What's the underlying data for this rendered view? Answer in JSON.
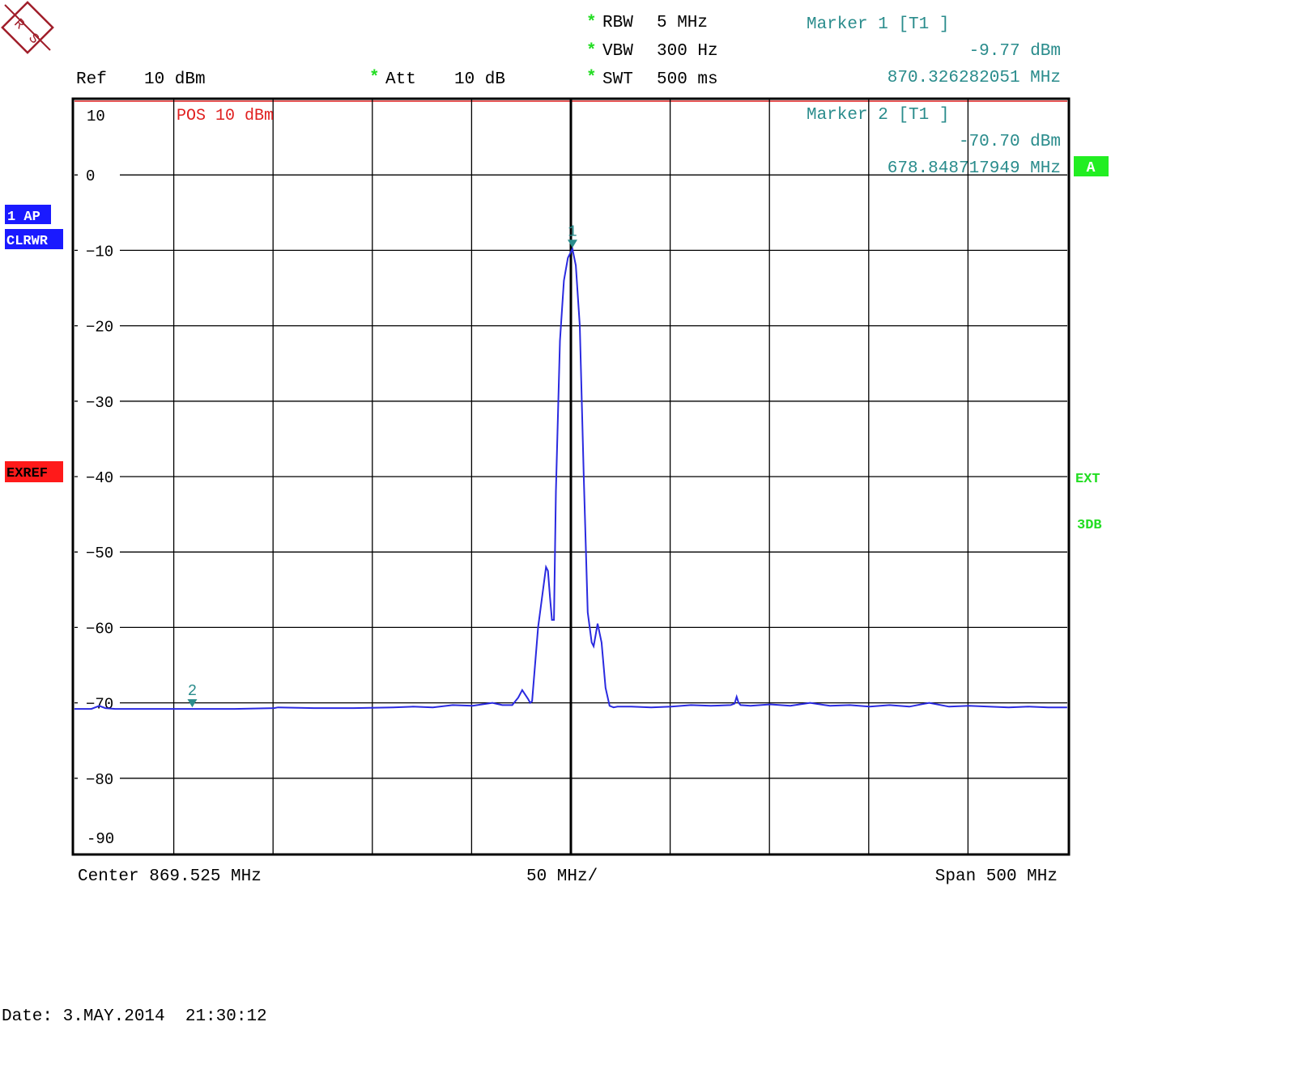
{
  "header": {
    "ref_label": "Ref",
    "ref_value": "10 dBm",
    "att_star": "*",
    "att_label": "Att",
    "att_value": "10 dB",
    "settings": [
      {
        "star": "*",
        "label": "RBW",
        "value": "5 MHz"
      },
      {
        "star": "*",
        "label": "VBW",
        "value": "300 Hz"
      },
      {
        "star": "*",
        "label": "SWT",
        "value": "500 ms"
      }
    ]
  },
  "markers": [
    {
      "title": "Marker 1 [T1 ]",
      "level": "-9.77 dBm",
      "freq": "870.326282051 MHz",
      "id": "1"
    },
    {
      "title": "Marker 2 [T1 ]",
      "level": "-70.70 dBm",
      "freq": "678.848717949 MHz",
      "id": "2"
    }
  ],
  "side_labels": {
    "trace": "1 AP",
    "mode": "CLRWR",
    "exref": "EXREF",
    "a": "A",
    "ext": "EXT",
    "db3": "3DB"
  },
  "grid": {
    "top_label": "10",
    "pos_label": "POS 10 dBm",
    "bottom_label": "-90"
  },
  "footer": {
    "center": "Center 869.525 MHz",
    "div": "50 MHz/",
    "span": "Span 500 MHz",
    "date": "Date: 3.MAY.2014  21:30:12"
  },
  "colors": {
    "trace": "#2a2ae0",
    "marker": "#2a8c8c",
    "star": "#22dd22",
    "red": "#e02020",
    "badge_blue": "#1a1aff",
    "badge_red": "#ff1a1a",
    "badge_green": "#22ee22"
  },
  "chart_data": {
    "type": "line",
    "xlabel": "",
    "ylabel": "",
    "xlim": [
      619.525,
      1119.525
    ],
    "ylim": [
      -90,
      10
    ],
    "y_ticks": [
      0,
      -10,
      -20,
      -30,
      -40,
      -50,
      -60,
      -70,
      -80
    ],
    "grid": true,
    "series": [
      {
        "x": [
          619.5,
          628,
          632,
          635,
          640,
          660,
          700,
          720,
          722,
          740,
          760,
          780,
          790,
          800,
          810,
          820,
          830,
          835,
          840,
          843,
          845,
          848,
          849,
          850,
          853,
          857,
          858,
          859,
          860,
          861,
          862,
          864,
          866,
          868,
          870.3,
          872,
          874,
          876,
          878,
          880,
          881,
          882,
          883,
          885,
          887,
          889,
          891,
          893,
          895,
          900,
          910,
          920,
          930,
          940,
          950,
          952,
          953,
          954,
          955,
          960,
          970,
          980,
          990,
          1000,
          1010,
          1020,
          1030,
          1040,
          1050,
          1060,
          1070,
          1080,
          1090,
          1100,
          1110,
          1119.5
        ],
        "y": [
          -70.8,
          -70.8,
          -70.4,
          -70.7,
          -70.8,
          -70.8,
          -70.8,
          -70.7,
          -70.6,
          -70.7,
          -70.7,
          -70.6,
          -70.5,
          -70.6,
          -70.3,
          -70.4,
          -70.0,
          -70.3,
          -70.3,
          -69.3,
          -68.3,
          -69.5,
          -70.0,
          -69.8,
          -60.0,
          -52.0,
          -52.5,
          -56.0,
          -59.0,
          -59.0,
          -42.0,
          -22.0,
          -14.0,
          -11.0,
          -9.8,
          -12.0,
          -20.0,
          -40.0,
          -58.0,
          -62.0,
          -62.5,
          -61.0,
          -59.5,
          -62.0,
          -68.0,
          -70.4,
          -70.6,
          -70.5,
          -70.5,
          -70.5,
          -70.6,
          -70.5,
          -70.3,
          -70.4,
          -70.3,
          -70.1,
          -69.2,
          -70.0,
          -70.3,
          -70.4,
          -70.2,
          -70.4,
          -70.0,
          -70.4,
          -70.3,
          -70.5,
          -70.3,
          -70.5,
          -70.0,
          -70.5,
          -70.4,
          -70.5,
          -70.6,
          -70.5,
          -70.6,
          -70.6
        ]
      }
    ],
    "markers": [
      {
        "id": "1",
        "x": 870.326,
        "y": -9.77
      },
      {
        "id": "2",
        "x": 678.849,
        "y": -70.7
      }
    ]
  }
}
